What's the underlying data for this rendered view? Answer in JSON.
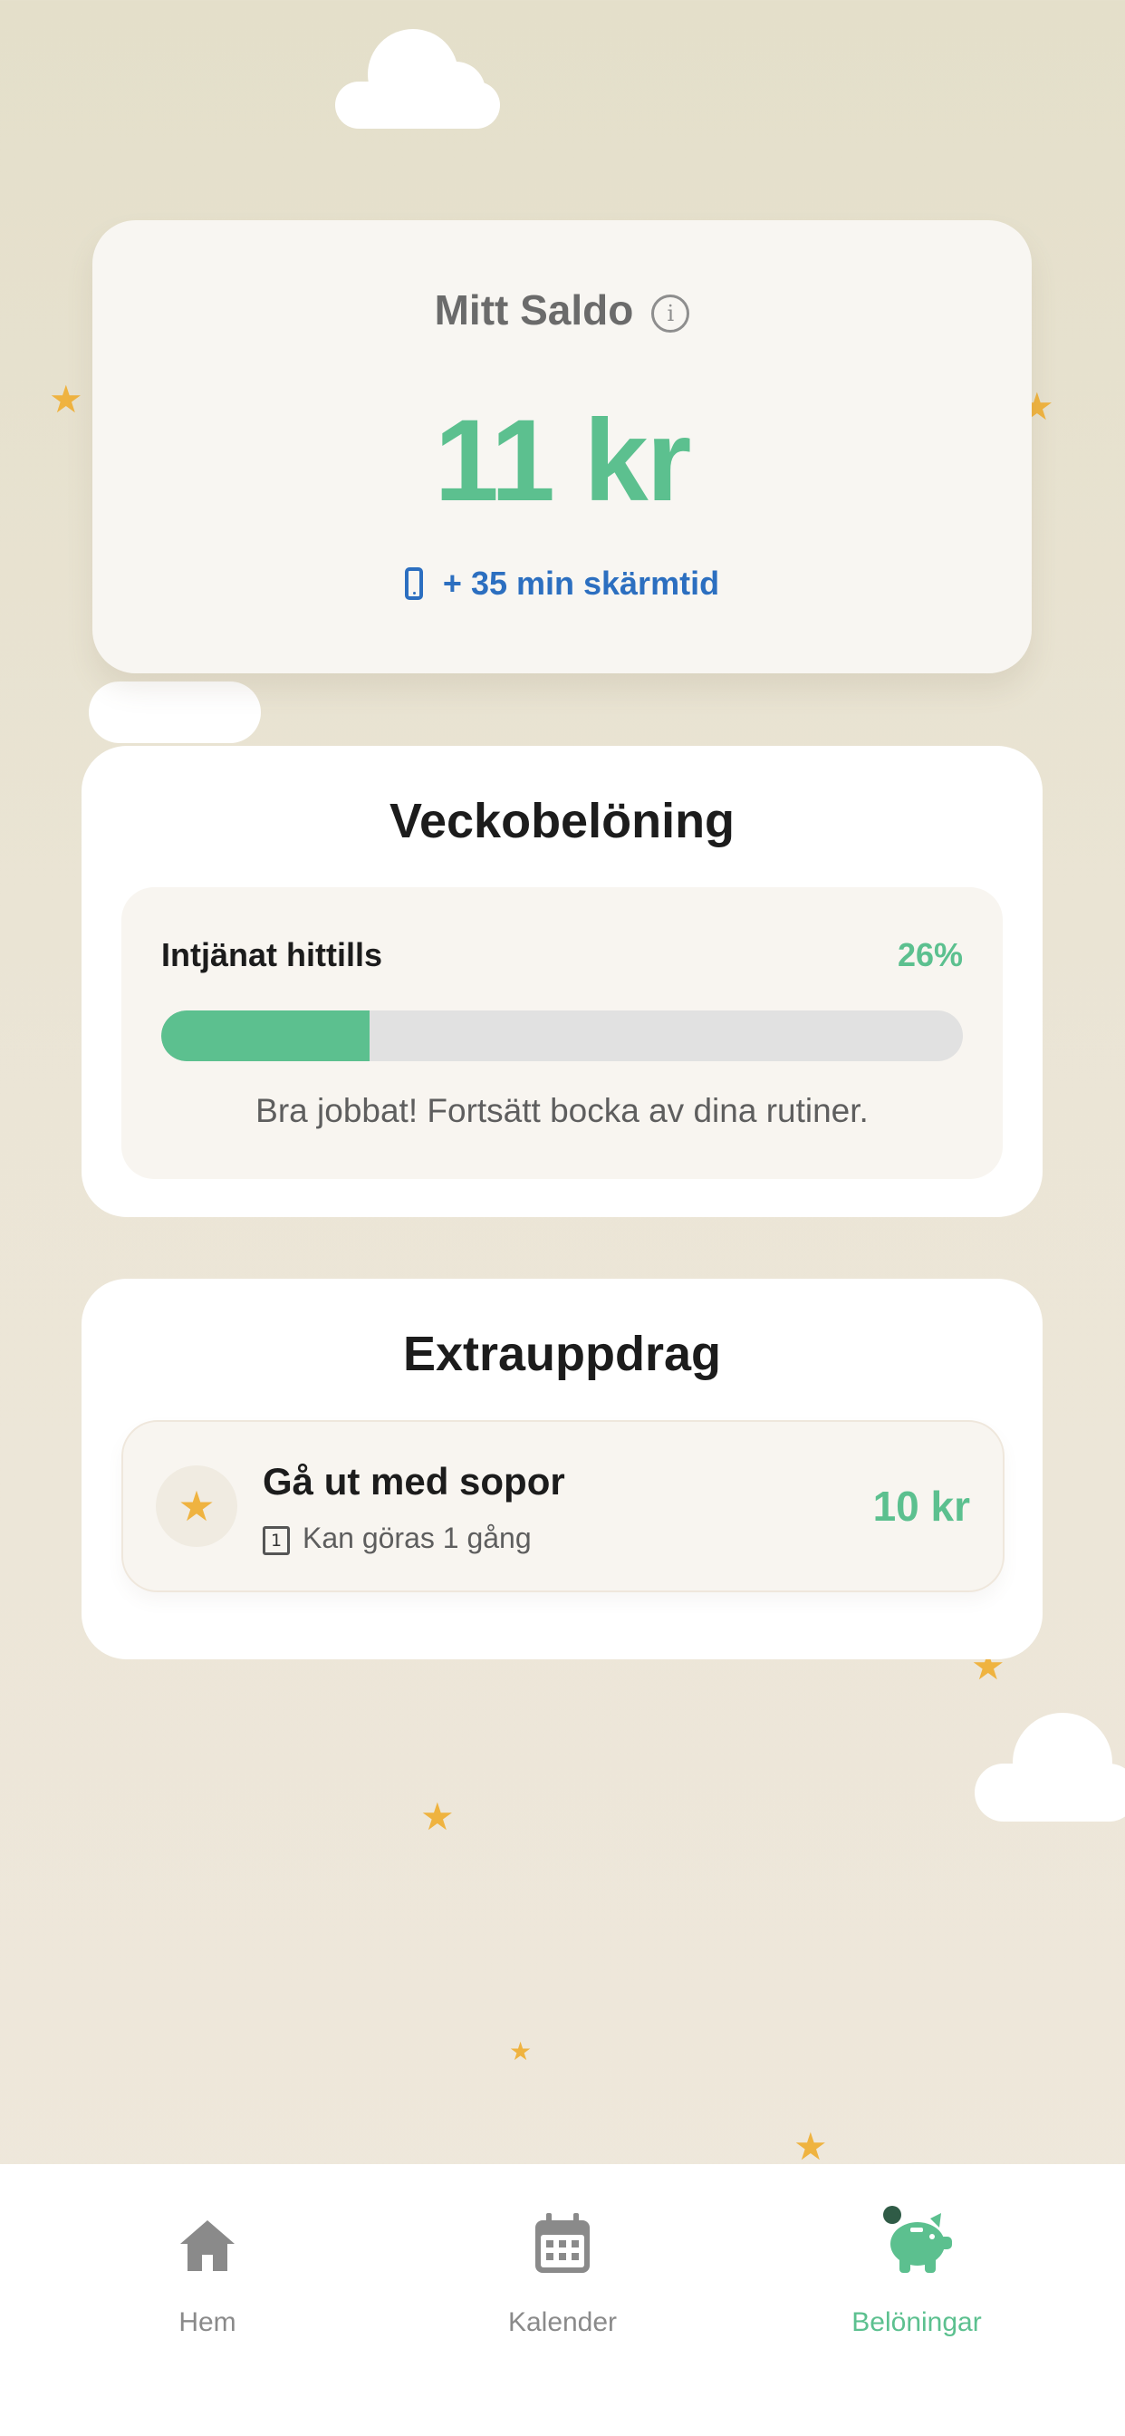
{
  "balance": {
    "title": "Mitt Saldo",
    "info_icon": "i",
    "amount": "11 kr",
    "screen_time": "+ 35 min skärmtid"
  },
  "weekly_reward": {
    "title": "Veckobelöning",
    "earned_label": "Intjänat hittills",
    "earned_percent_text": "26%",
    "progress_fraction": 0.26,
    "message": "Bra jobbat! Fortsätt bocka av dina rutiner."
  },
  "extra_tasks": {
    "title": "Extrauppdrag",
    "items": [
      {
        "title": "Gå ut med sopor",
        "count_badge": "1",
        "subtitle": "Kan göras 1 gång",
        "reward": "10 kr",
        "icon": "star-icon"
      }
    ]
  },
  "nav": {
    "items": [
      {
        "label": "Hem",
        "icon": "home-icon"
      },
      {
        "label": "Kalender",
        "icon": "calendar-icon"
      },
      {
        "label": "Belöningar",
        "icon": "piggy-bank-icon",
        "active": true
      }
    ]
  },
  "colors": {
    "accent_green": "#5cc08f",
    "link_blue": "#2c6fc0",
    "star_gold": "#efb340",
    "background": "#e8e2d2"
  }
}
